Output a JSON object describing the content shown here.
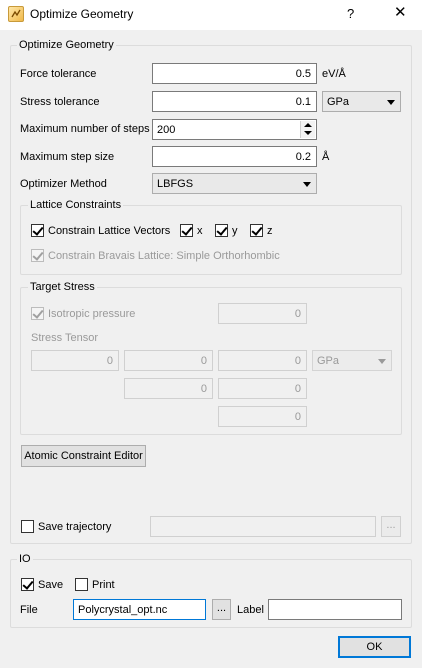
{
  "window": {
    "title": "Optimize Geometry",
    "help_label": "?",
    "close_label": "✕",
    "icon": "app-icon"
  },
  "optimize_group": {
    "title": "Optimize Geometry",
    "force_tolerance": {
      "label": "Force tolerance",
      "value": "0.5",
      "unit": "eV/Å"
    },
    "stress_tolerance": {
      "label": "Stress tolerance",
      "value": "0.1",
      "unit": "GPa"
    },
    "max_steps": {
      "label": "Maximum number of steps",
      "value": "200"
    },
    "max_step_size": {
      "label": "Maximum step size",
      "value": "0.2",
      "unit": "Å"
    },
    "optimizer_method": {
      "label": "Optimizer Method",
      "value": "LBFGS"
    }
  },
  "lattice_constraints": {
    "title": "Lattice Constraints",
    "constrain_vectors": {
      "label": "Constrain Lattice Vectors",
      "checked": true
    },
    "x": {
      "label": "x",
      "checked": true
    },
    "y": {
      "label": "y",
      "checked": true
    },
    "z": {
      "label": "z",
      "checked": true
    },
    "bravais": {
      "label": "Constrain Bravais Lattice: Simple Orthorhombic",
      "checked": true,
      "enabled": false
    }
  },
  "target_stress": {
    "title": "Target Stress",
    "isotropic": {
      "label": "Isotropic pressure",
      "checked": true,
      "value": "0"
    },
    "tensor_label": "Stress Tensor",
    "tensor": [
      "0",
      "0",
      "0",
      "0",
      "0",
      "0"
    ],
    "unit": "GPa"
  },
  "atomic_constraint_button": "Atomic Constraint Editor",
  "save_trajectory": {
    "label": "Save trajectory",
    "checked": false,
    "value": "",
    "browse_label": "..."
  },
  "io": {
    "title": "IO",
    "save": {
      "label": "Save",
      "checked": true
    },
    "print": {
      "label": "Print",
      "checked": false
    },
    "file_label": "File",
    "file_value": "Polycrystal_opt.nc",
    "browse_label": "...",
    "label_label": "Label",
    "label_value": ""
  },
  "ok_button": "OK"
}
